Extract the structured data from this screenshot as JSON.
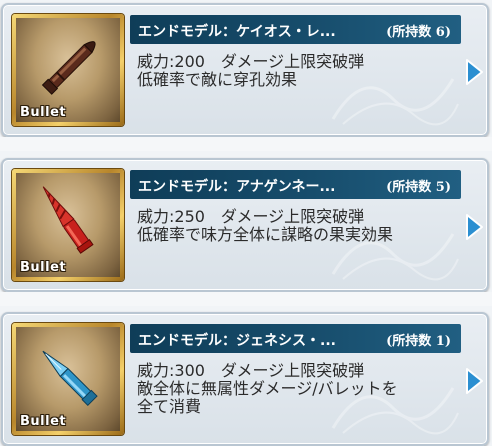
{
  "items": [
    {
      "title": "エンドモデル：ケイオス・レ...",
      "count": "(所持数 6)",
      "line1": "威力:200　ダメージ上限突破弾",
      "line2": "低確率で敵に穿孔効果",
      "line3": "",
      "tag": "Bullet",
      "bullet_color": "#6b2b1a",
      "icon": "bullet-icon"
    },
    {
      "title": "エンドモデル：アナゲンネー...",
      "count": "(所持数 5)",
      "line1": "威力:250　ダメージ上限突破弾",
      "line2": "低確率で味方全体に謀略の果実効果",
      "line3": "",
      "tag": "Bullet",
      "bullet_color": "#d4302a",
      "icon": "bullet-icon"
    },
    {
      "title": "エンドモデル：ジェネシス・...",
      "count": "(所持数 1)",
      "line1": "威力:300　ダメージ上限突破弾",
      "line2": "敵全体に無属性ダメージ/バレットを",
      "line3": "全て消費",
      "tag": "Bullet",
      "bullet_color": "#3aa6d6",
      "icon": "bullet-icon"
    }
  ],
  "colors": {
    "title_bar": "#174d6c",
    "arrow": "#2b8fd1",
    "frame_gold": "#d6a93c"
  }
}
